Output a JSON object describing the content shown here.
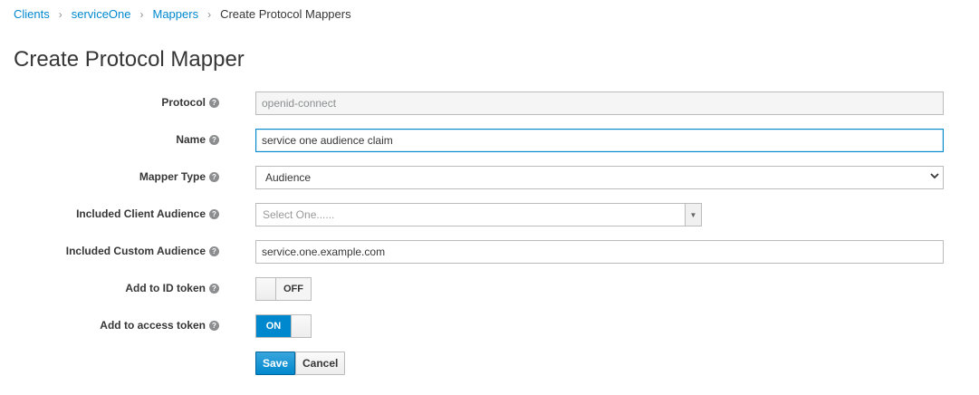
{
  "breadcrumb": {
    "items": [
      "Clients",
      "serviceOne",
      "Mappers"
    ],
    "current": "Create Protocol Mappers"
  },
  "page": {
    "title": "Create Protocol Mapper"
  },
  "form": {
    "protocol": {
      "label": "Protocol",
      "value": "openid-connect"
    },
    "name": {
      "label": "Name",
      "value": "service one audience claim"
    },
    "mapper_type": {
      "label": "Mapper Type",
      "value": "Audience"
    },
    "client_audience": {
      "label": "Included Client Audience",
      "placeholder": "Select One......"
    },
    "custom_audience": {
      "label": "Included Custom Audience",
      "value": "service.one.example.com"
    },
    "id_token": {
      "label": "Add to ID token",
      "state": "OFF"
    },
    "access_token": {
      "label": "Add to access token",
      "state": "ON"
    }
  },
  "buttons": {
    "save": "Save",
    "cancel": "Cancel"
  },
  "colors": {
    "accent": "#0088ce",
    "text": "#363636",
    "border": "#bbbbbb"
  },
  "icons": {
    "help": "question-circle-icon",
    "dropdown": "chevron-down-icon",
    "select_arrow": "caret-down-icon"
  }
}
